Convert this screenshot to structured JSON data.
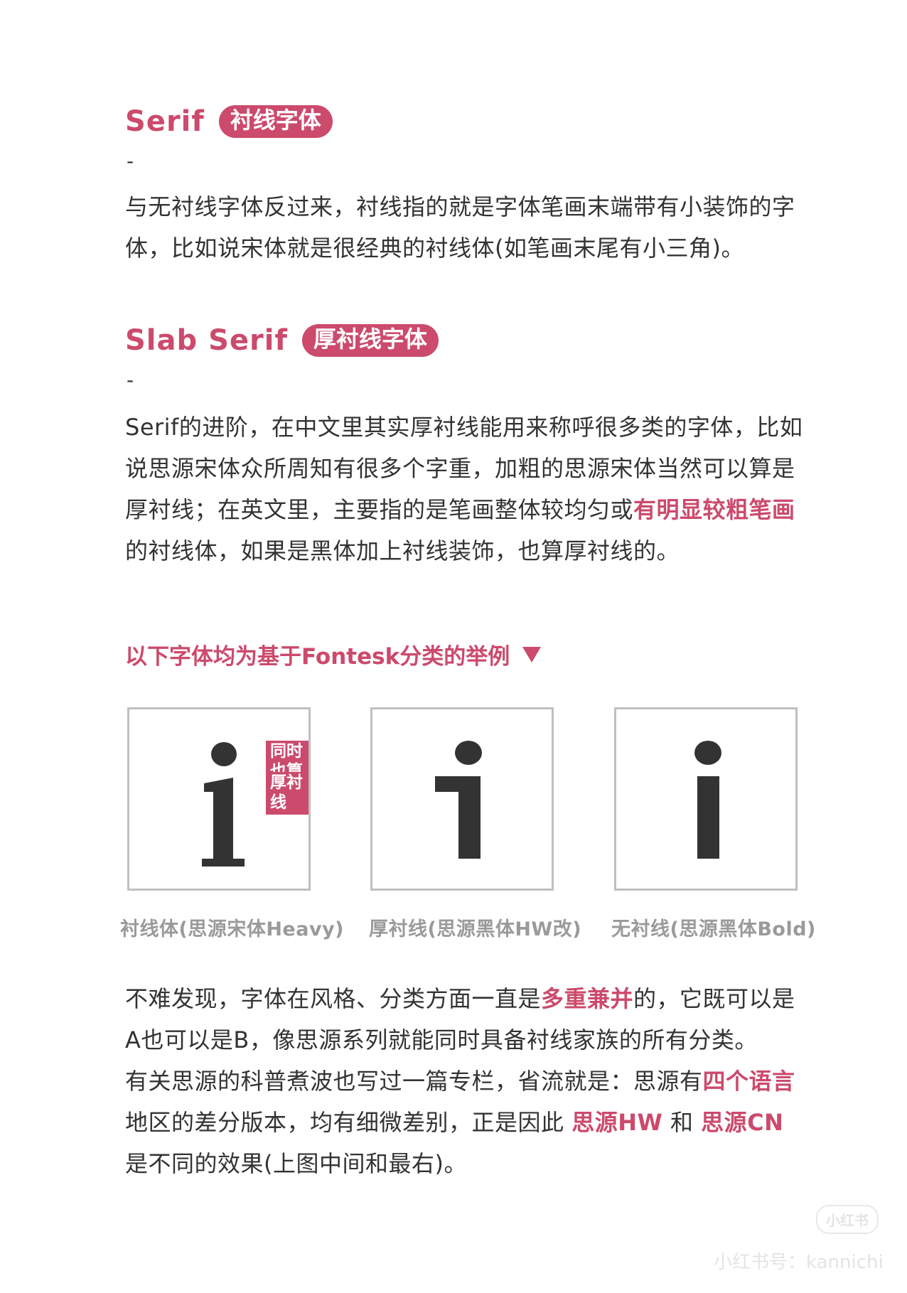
{
  "section1": {
    "title_en": "Serif",
    "title_cn": "衬线字体",
    "dash": "-",
    "para": "与无衬线字体反过来，衬线指的就是字体笔画末端带有小装饰的字体，比如说宋体就是很经典的衬线体(如笔画末尾有小三角)。"
  },
  "section2": {
    "title_en": "Slab Serif",
    "title_cn": "厚衬线字体",
    "dash": "-",
    "para_a": "Serif的进阶，在中文里其实厚衬线能用来称呼很多类的字体，比如说思源宋体众所周知有很多个字重，加粗的思源宋体当然可以算是厚衬线；在英文里，主要指的是笔画整体较均匀或",
    "para_highlight": "有明显较粗笔画",
    "para_b": "的衬线体，如果是黑体加上衬线装饰，也算厚衬线的。"
  },
  "examples": {
    "heading": "以下字体均为基于Fontesk分类的举例",
    "tag_line1": "同时也算",
    "tag_line2": "厚衬线",
    "captions": [
      "衬线体(思源宋体Heavy)",
      "厚衬线(思源黑体HW改)",
      "无衬线(思源黑体Bold)"
    ]
  },
  "closing": {
    "p1_a": "不难发现，字体在风格、分类方面一直是",
    "p1_hl": "多重兼并",
    "p1_b": "的，它既可以是A也可以是B，像思源系列就能同时具备衬线家族的所有分类。",
    "p2_a": "有关思源的科普煮波也写过一篇专栏，省流就是：思源有",
    "p2_hl1": "四个语言",
    "p2_b": "地区的差分版本，均有细微差别，正是因此 ",
    "p2_hl2": "思源HW",
    "p2_c": " 和 ",
    "p2_hl3": "思源CN",
    "p2_d": " 是不同的效果(上图中间和最右)。"
  },
  "watermark": {
    "logo": "小红书",
    "text": "小红书号：kannichi"
  },
  "colors": {
    "accent": "#cc4a6c",
    "text": "#333333",
    "caption": "#9a9a9a",
    "box_border": "#c0c0c0"
  }
}
